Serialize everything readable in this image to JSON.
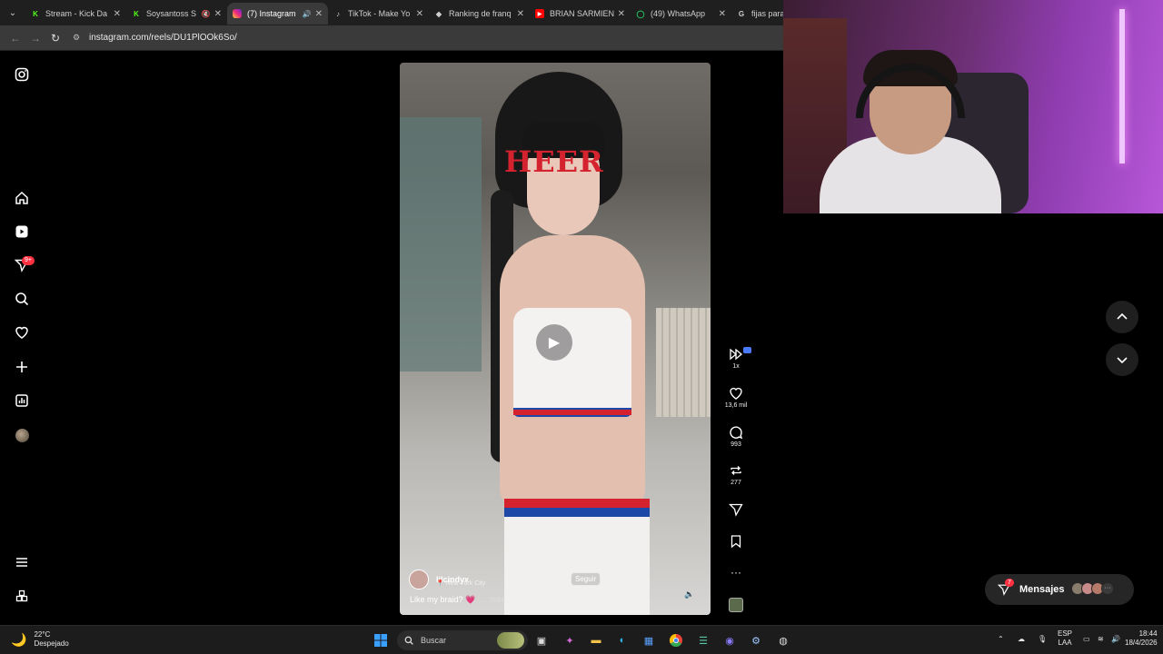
{
  "browser": {
    "tabs": [
      {
        "title": "Stream - Kick Da",
        "icon": "kick-icon",
        "color": "#53fc18"
      },
      {
        "title": "Soysantoss S",
        "icon": "kick-icon",
        "color": "#53fc18",
        "muted": true
      },
      {
        "title": "(7) Instagram",
        "icon": "instagram-icon",
        "color": "#e1306c",
        "active": true,
        "audio": true
      },
      {
        "title": "TikTok - Make Yo",
        "icon": "tiktok-icon",
        "color": "#ffffff"
      },
      {
        "title": "Ranking de franq",
        "icon": "diamond-icon",
        "color": "#ffffff"
      },
      {
        "title": "BRIAN SARMIENT",
        "icon": "youtube-icon",
        "color": "#ff0000"
      },
      {
        "title": "(49) WhatsApp",
        "icon": "whatsapp-icon",
        "color": "#25d366"
      },
      {
        "title": "fijas para la",
        "icon": "google-icon",
        "color": "#ffffff"
      }
    ],
    "url": "instagram.com/reels/DU1PlOOk6So/"
  },
  "sidebar": {
    "notifications_badge": "9+"
  },
  "reel": {
    "shirt_text": "HEER",
    "username": "lilcindyx",
    "location": "New York City",
    "follow_label": "Seguir",
    "caption": "Like my braid?",
    "caption_more": "... más",
    "heart_emoji": "💗"
  },
  "actions": {
    "speed": "1x",
    "likes": "13,6 mil",
    "comments": "993",
    "reposts": "277"
  },
  "messages": {
    "label": "Mensajes",
    "badge": "7"
  },
  "taskbar": {
    "temperature": "22°C",
    "weather": "Despejado",
    "search_placeholder": "Buscar",
    "lang_top": "ESP",
    "lang_bottom": "LAA",
    "time": "18:44",
    "date": "18/4/2026"
  },
  "colors": {
    "accent_red": "#ff3040",
    "bg": "#000000"
  }
}
